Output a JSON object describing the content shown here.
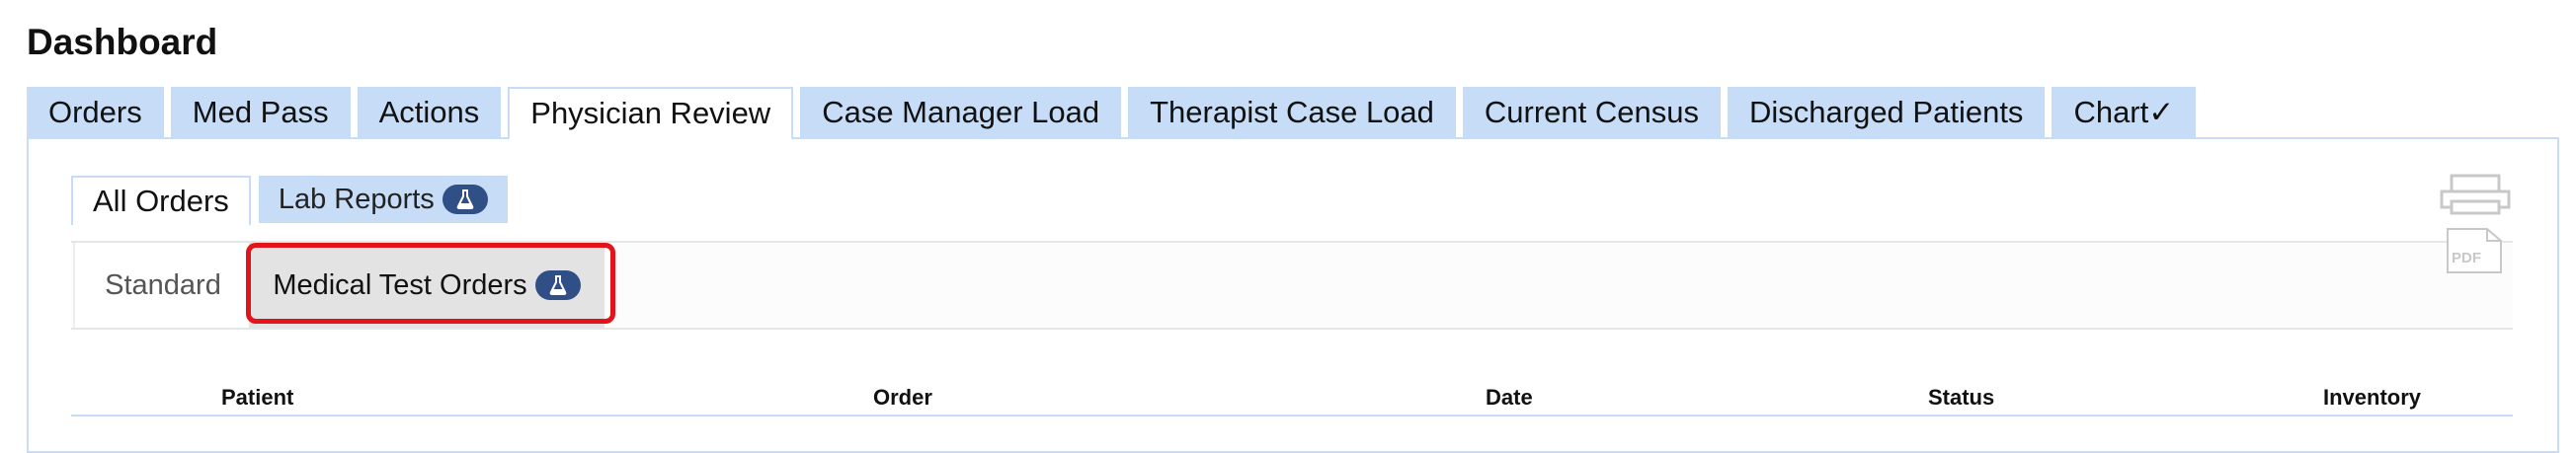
{
  "page": {
    "title": "Dashboard"
  },
  "main_tabs": [
    {
      "label": "Orders"
    },
    {
      "label": "Med Pass"
    },
    {
      "label": "Actions"
    },
    {
      "label": "Physician Review"
    },
    {
      "label": "Case Manager Load"
    },
    {
      "label": "Therapist Case Load"
    },
    {
      "label": "Current Census"
    },
    {
      "label": "Discharged Patients"
    },
    {
      "label": "Chart✓"
    }
  ],
  "active_main_tab": "Physician Review",
  "sub_tabs": [
    {
      "label": "All Orders"
    },
    {
      "label": "Lab Reports",
      "icon": "flask-icon"
    }
  ],
  "active_sub_tab": "All Orders",
  "order_type_tabs": [
    {
      "label": "Standard"
    },
    {
      "label": "Medical Test Orders",
      "icon": "flask-icon"
    }
  ],
  "active_order_type_tab": "Medical Test Orders",
  "toolbar": {
    "print_icon": "printer-icon",
    "pdf_icon": "pdf-icon",
    "pdf_label": "PDF"
  },
  "table": {
    "columns": [
      "Patient",
      "Order",
      "Date",
      "Status",
      "Inventory"
    ]
  },
  "colors": {
    "tab_blue": "#c7ddf7",
    "badge_navy": "#2f4f86",
    "highlight_red": "#e3131b"
  }
}
